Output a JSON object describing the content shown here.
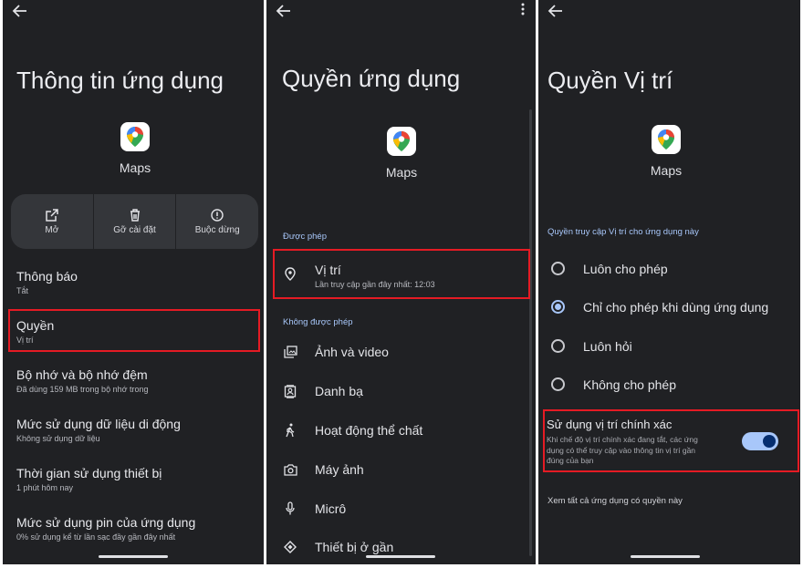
{
  "colors": {
    "background": "#202124",
    "highlight_box": "#e51b24",
    "accent": "#a8c7fa",
    "text": "#e6e6ea"
  },
  "panel1": {
    "title": "Thông tin ứng dụng",
    "app_name": "Maps",
    "actions": [
      {
        "label": "Mở",
        "icon": "open-external-icon"
      },
      {
        "label": "Gỡ cài đặt",
        "icon": "trash-icon"
      },
      {
        "label": "Buộc dừng",
        "icon": "alert-circle-icon"
      }
    ],
    "items": [
      {
        "title": "Thông báo",
        "subtitle": "Tắt"
      },
      {
        "title": "Quyền",
        "subtitle": "Vị trí"
      },
      {
        "title": "Bộ nhớ và bộ nhớ đệm",
        "subtitle": "Đã dùng 159 MB trong bộ nhớ trong"
      },
      {
        "title": "Mức sử dụng dữ liệu di động",
        "subtitle": "Không sử dụng dữ liệu"
      },
      {
        "title": "Thời gian sử dụng thiết bị",
        "subtitle": "1 phút hôm nay"
      },
      {
        "title": "Mức sử dụng pin của ứng dụng",
        "subtitle": "0% sử dụng kể từ lần sạc đầy gần đây nhất"
      }
    ]
  },
  "panel2": {
    "title": "Quyền ứng dụng",
    "app_name": "Maps",
    "allowed_header": "Được phép",
    "allowed": [
      {
        "title": "Vị trí",
        "subtitle": "Lần truy cập gần đây nhất: 12:03",
        "icon": "location-pin-icon"
      }
    ],
    "not_allowed_header": "Không được phép",
    "not_allowed": [
      {
        "label": "Ảnh và video",
        "icon": "photo-library-icon"
      },
      {
        "label": "Danh bạ",
        "icon": "contacts-icon"
      },
      {
        "label": "Hoạt động thể chất",
        "icon": "walking-person-icon"
      },
      {
        "label": "Máy ảnh",
        "icon": "camera-icon"
      },
      {
        "label": "Micrô",
        "icon": "microphone-icon"
      },
      {
        "label": "Thiết bị ở gần",
        "icon": "nearby-devices-icon"
      }
    ]
  },
  "panel3": {
    "title": "Quyền Vị trí",
    "app_name": "Maps",
    "section_header": "Quyền truy cập Vị trí cho ứng dụng này",
    "options": [
      {
        "label": "Luôn cho phép",
        "selected": false
      },
      {
        "label": "Chỉ cho phép khi dùng ứng dụng",
        "selected": true
      },
      {
        "label": "Luôn hỏi",
        "selected": false
      },
      {
        "label": "Không cho phép",
        "selected": false
      }
    ],
    "precise": {
      "title": "Sử dụng vị trí chính xác",
      "description_line1": "Khi chế độ vị trí chính xác đang tắt, các ứng",
      "description_line2": "dụng có thể truy cập vào thông tin vị trí gần",
      "description_line3": "đúng của bạn",
      "enabled": true
    },
    "see_all": "Xem tất cả ứng dụng có quyền này"
  }
}
